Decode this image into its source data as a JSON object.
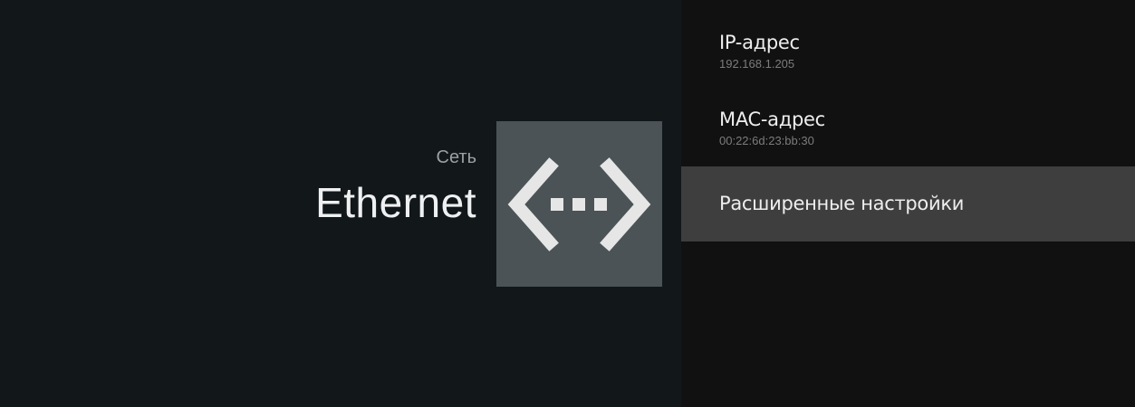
{
  "header": {
    "breadcrumb": "Сеть",
    "title": "Ethernet",
    "icon": "ethernet-icon"
  },
  "list": {
    "items": [
      {
        "title": "IP-адрес",
        "subtitle": "192.168.1.205"
      },
      {
        "title": "MAC-адрес",
        "subtitle": "00:22:6d:23:bb:30"
      },
      {
        "title": "Расширенные настройки",
        "focused": true
      }
    ]
  },
  "colors": {
    "left_bg": "#12171a",
    "right_bg": "#111111",
    "focused_bg": "#3e3e3e",
    "icon_tile": "#4b5356",
    "icon_fg": "#e6e6e6"
  }
}
